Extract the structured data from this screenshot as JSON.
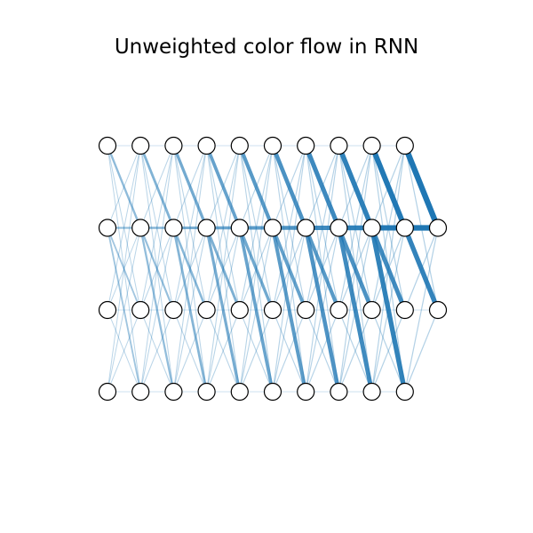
{
  "title": "Unweighted color flow in RNN",
  "colors": {
    "edge": "#1f77b4",
    "node_fill": "#ffffff",
    "node_stroke": "#000000"
  },
  "network": {
    "num_columns": 11,
    "rows_per_column": [
      4,
      4,
      4,
      4,
      4,
      4,
      4,
      4,
      4,
      4,
      2
    ],
    "last_column_rows": [
      1,
      2
    ],
    "strong_flow": [
      {
        "from": [
          9,
          0
        ],
        "to": [
          10,
          1
        ]
      },
      {
        "from": [
          9,
          1
        ],
        "to": [
          10,
          1
        ]
      },
      {
        "from": [
          9,
          3
        ],
        "to": [
          10,
          1
        ]
      },
      {
        "from": [
          9,
          2
        ],
        "to": [
          10,
          2
        ]
      }
    ]
  }
}
